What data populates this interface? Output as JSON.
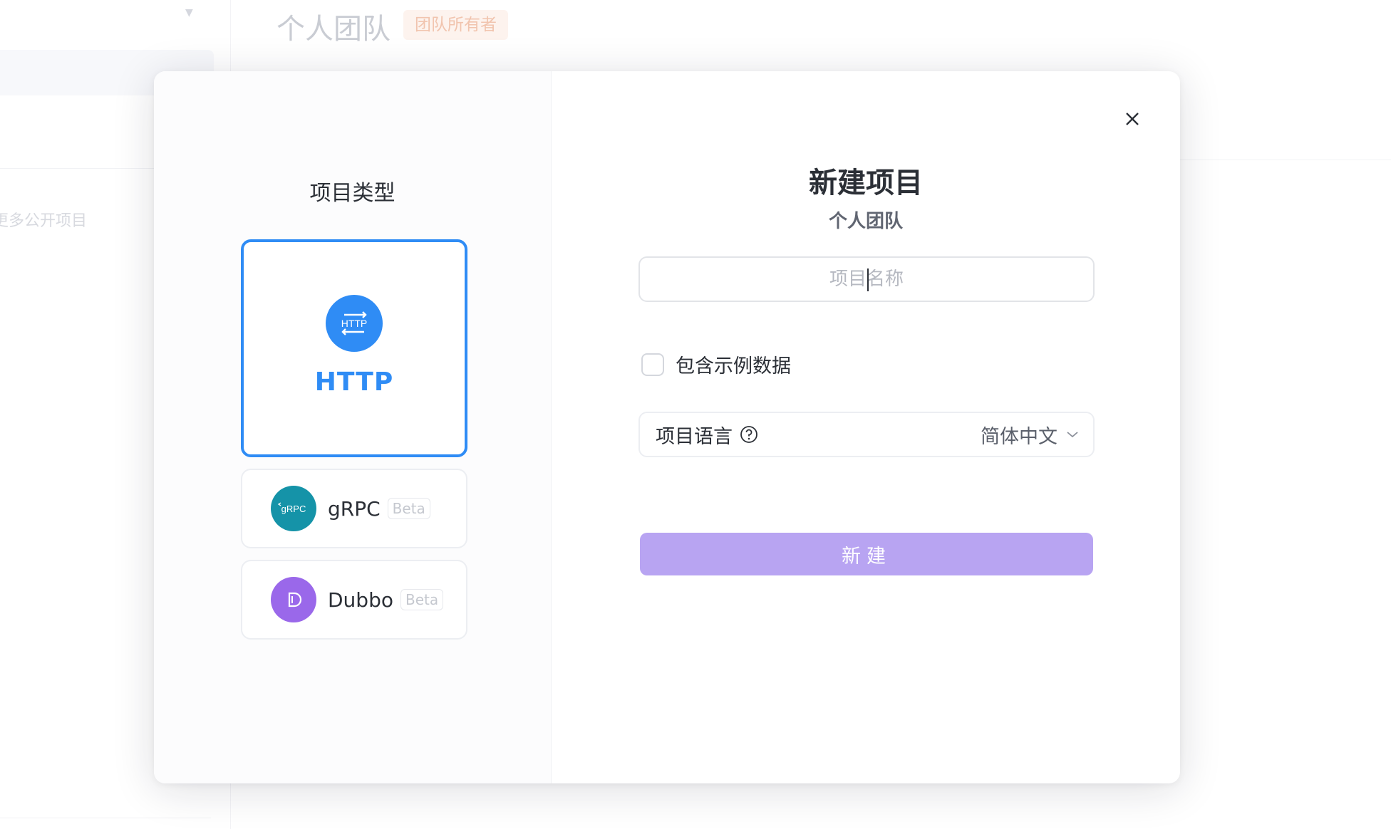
{
  "background": {
    "header_title": "个人团队",
    "header_badge": "团队所有者",
    "sidebar_more_link": "更多公开项目"
  },
  "modal": {
    "type_heading": "项目类型",
    "types": [
      {
        "label": "HTTP",
        "icon": "http-icon",
        "selected": true
      },
      {
        "label": "gRPC",
        "badge": "Beta",
        "icon": "grpc-icon"
      },
      {
        "label": "Dubbo",
        "badge": "Beta",
        "icon": "dubbo-icon"
      }
    ],
    "title": "新建项目",
    "subtitle": "个人团队",
    "name_input": {
      "value": "",
      "placeholder": "项目名称"
    },
    "sample_data": {
      "label": "包含示例数据",
      "checked": false
    },
    "language": {
      "label": "项目语言",
      "value": "简体中文"
    },
    "create_button": "新建"
  },
  "colors": {
    "accent_blue": "#2f8cf5",
    "grpc_teal": "#1593a8",
    "dubbo_purple": "#9a68ea",
    "create_button": "#b8a4f2"
  }
}
